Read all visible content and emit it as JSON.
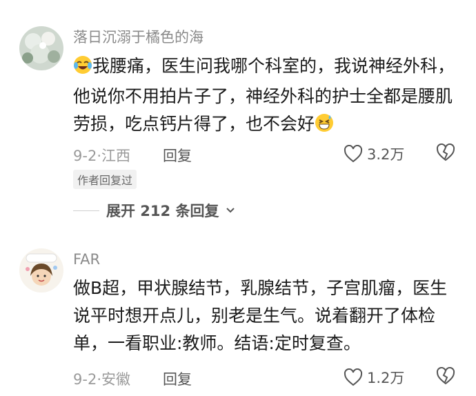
{
  "comments": [
    {
      "username": "落日沉溺于橘色的海",
      "text_before_emoji": "",
      "text": "我腰痛，医生问我哪个科室的，我说神经外科，他说你不用拍片子了，神经外科的护士全都是腰肌劳损，吃点钙片得了，也不会好",
      "lead_emoji": "crying-laughing-emoji",
      "trail_emoji": "grinning-sweat-emoji",
      "date": "9-2",
      "location": "江西",
      "reply_label": "回复",
      "likes": "3.2万",
      "author_badge": "作者回复过",
      "expand_label": "展开 212 条回复"
    },
    {
      "username": "FAR",
      "text": "做B超，甲状腺结节，乳腺结节，子宫肌瘤，医生说平时想开点儿，别老是生气。说着翻开了体检单，一看职业:教师。结语:定时复查。",
      "date": "9-2",
      "location": "安徽",
      "reply_label": "回复",
      "likes": "1.2万"
    }
  ],
  "colors": {
    "name": "#8a8a8a",
    "text": "#1a1a1a",
    "meta": "#9a9a9a"
  }
}
